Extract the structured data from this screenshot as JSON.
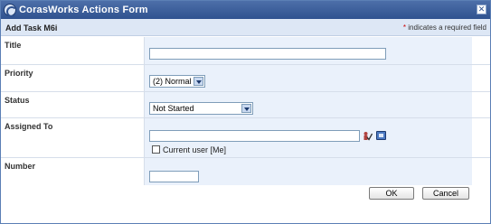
{
  "window": {
    "title": "CorasWorks Actions Form"
  },
  "subheader": {
    "heading": "Add Task M6i",
    "required_star": "*",
    "required_note": "indicates a required field"
  },
  "fields": {
    "title": {
      "label": "Title",
      "value": ""
    },
    "priority": {
      "label": "Priority",
      "selected": "(2) Normal"
    },
    "status": {
      "label": "Status",
      "selected": "Not Started"
    },
    "assigned_to": {
      "label": "Assigned To",
      "value": "",
      "current_user_label": "Current user [Me]",
      "current_user_checked": false
    },
    "number": {
      "label": "Number",
      "value": ""
    }
  },
  "buttons": {
    "ok": "OK",
    "cancel": "Cancel"
  },
  "icons": {
    "logo": "corasworks-logo-icon",
    "close": "close-icon",
    "check_names": "check-names-icon",
    "address_book": "address-book-icon"
  }
}
